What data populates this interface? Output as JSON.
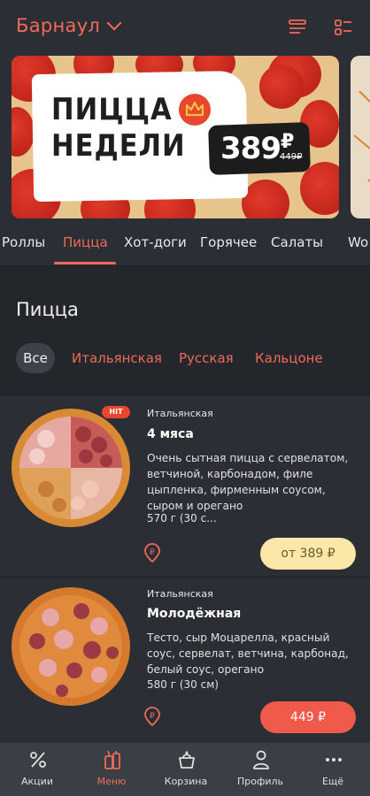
{
  "header": {
    "city": "Барнаул",
    "icons": [
      "list-view-icon",
      "grid-list-icon"
    ],
    "accent": "#f06a57"
  },
  "banner": {
    "title_line1": "ПИЦЦА",
    "title_line2": "НЕДЕЛИ",
    "price": "389",
    "currency": "₽",
    "old_price": "449₽"
  },
  "categories": [
    "Роллы",
    "Пицца",
    "Хот-доги",
    "Горячее",
    "Салаты",
    "Wo"
  ],
  "active_category": "Пицца",
  "section": {
    "title": "Пицца",
    "filters": [
      "Все",
      "Итальянская",
      "Русская",
      "Кальцоне"
    ]
  },
  "products": [
    {
      "badge": "HIT",
      "category": "Итальянская",
      "name": "4 мяса",
      "description": "Очень сытная пицца с сервелатом, ветчиной, карбонадом, филе цыпленка, фирменным соусом, сыром и орегано",
      "weight": "570 г (30 с...",
      "price": "от 389 ₽"
    },
    {
      "category": "Итальянская",
      "name": "Молодёжная",
      "description": "Тесто, сыр Моцарелла, красный соус, сервелат, ветчина, карбонад, белый соус, орегано",
      "weight": "580 г (30 см)",
      "price": "449 ₽"
    }
  ],
  "tabbar": [
    {
      "label": "Акции",
      "icon": "percent-icon"
    },
    {
      "label": "Меню",
      "icon": "menu-drinks-icon"
    },
    {
      "label": "Корзина",
      "icon": "basket-icon"
    },
    {
      "label": "Профиль",
      "icon": "profile-icon"
    },
    {
      "label": "Ещё",
      "icon": "more-dots-icon"
    }
  ],
  "active_tab": "Меню"
}
